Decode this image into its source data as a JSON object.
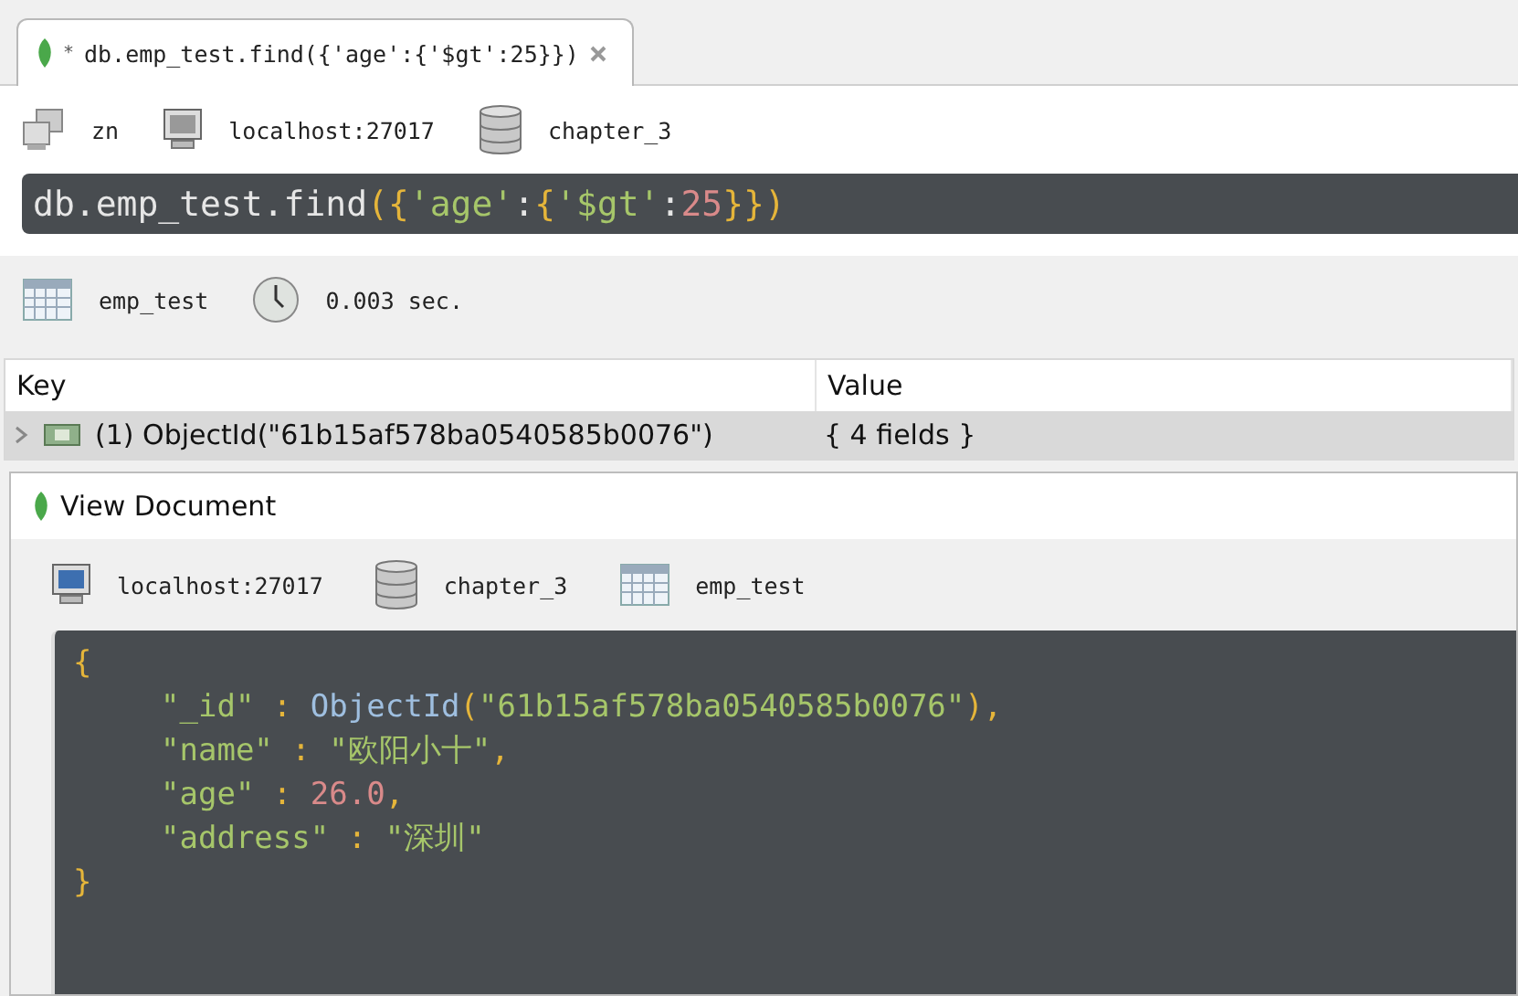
{
  "tab": {
    "marker": "*",
    "title": "db.emp_test.find({'age':{'$gt':25}})",
    "selected": true
  },
  "connection_bar": {
    "user": "zn",
    "server": "localhost:27017",
    "database": "chapter_3"
  },
  "query": [
    {
      "kind": "plain",
      "text": "db.emp_test.find"
    },
    {
      "kind": "punct",
      "text": "({"
    },
    {
      "kind": "string",
      "text": "'age'"
    },
    {
      "kind": "plain",
      "text": ":"
    },
    {
      "kind": "punct",
      "text": "{"
    },
    {
      "kind": "string",
      "text": "'$gt'"
    },
    {
      "kind": "plain",
      "text": ":"
    },
    {
      "kind": "number",
      "text": "25"
    },
    {
      "kind": "punct",
      "text": "}})"
    }
  ],
  "result_bar": {
    "collection": "emp_test",
    "time": "0.003 sec."
  },
  "table": {
    "columns": [
      "Key",
      "Value"
    ],
    "rows": [
      {
        "key": "(1) ObjectId(\"61b15af578ba0540585b0076\")",
        "value": "{ 4 fields }",
        "selected": true,
        "expanded": false
      }
    ]
  },
  "view_document": {
    "title": "View Document",
    "server": "localhost:27017",
    "database": "chapter_3",
    "collection": "emp_test",
    "lines": [
      [
        {
          "kind": "punct",
          "text": "{"
        }
      ],
      [
        {
          "kind": "string",
          "text": "\"_id\""
        },
        {
          "kind": "punct",
          "text": " : "
        },
        {
          "kind": "func",
          "text": "ObjectId"
        },
        {
          "kind": "punct",
          "text": "("
        },
        {
          "kind": "string",
          "text": "\"61b15af578ba0540585b0076\""
        },
        {
          "kind": "punct",
          "text": "),"
        }
      ],
      [
        {
          "kind": "string",
          "text": "\"name\""
        },
        {
          "kind": "punct",
          "text": " : "
        },
        {
          "kind": "string",
          "text": "\"欧阳小十\""
        },
        {
          "kind": "punct",
          "text": ","
        }
      ],
      [
        {
          "kind": "string",
          "text": "\"age\""
        },
        {
          "kind": "punct",
          "text": " : "
        },
        {
          "kind": "number",
          "text": "26.0"
        },
        {
          "kind": "punct",
          "text": ","
        }
      ],
      [
        {
          "kind": "string",
          "text": "\"address\""
        },
        {
          "kind": "punct",
          "text": " : "
        },
        {
          "kind": "string",
          "text": "\"深圳\""
        }
      ],
      [
        {
          "kind": "punct",
          "text": "}"
        }
      ]
    ]
  }
}
